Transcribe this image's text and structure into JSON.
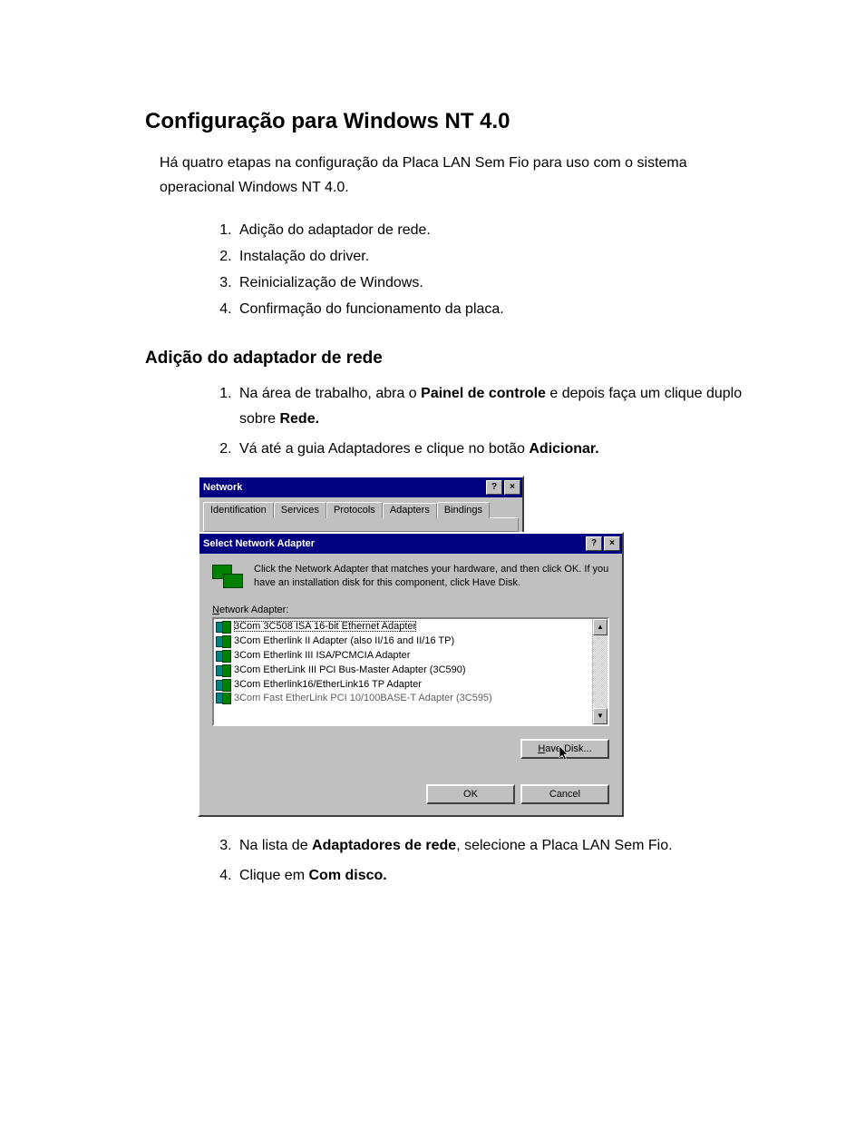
{
  "doc": {
    "title": "Configuração para Windows NT 4.0",
    "intro": "Há quatro etapas na configuração da Placa LAN Sem Fio para uso com o sistema operacional Windows NT 4.0.",
    "steps": [
      "Adição do adaptador de rede.",
      "Instalação do driver.",
      "Reinicialização de Windows.",
      "Confirmação do funcionamento da placa."
    ],
    "section1_title": "Adição do adaptador de rede",
    "sub1": {
      "a_pre": "Na área de trabalho, abra o ",
      "a_b1": "Painel de controle",
      "a_mid": " e depois faça um clique duplo sobre ",
      "a_b2": "Rede.",
      "b_pre": "Vá até a guia Adaptadores e clique no botão ",
      "b_b1": "Adicionar."
    },
    "sub2": {
      "c_pre": "Na lista de ",
      "c_b1": "Adaptadores de rede",
      "c_post": ", selecione a Placa LAN Sem Fio.",
      "d_pre": "Clique em ",
      "d_b1": "Com disco."
    }
  },
  "dialog": {
    "outer_title": "Network",
    "tabs": [
      "Identification",
      "Services",
      "Protocols",
      "Adapters",
      "Bindings"
    ],
    "active_tab_index": 3,
    "inner_title": "Select Network Adapter",
    "instruction": "Click the Network Adapter that matches your hardware, and then click OK.  If you have an installation disk for this component, click Have Disk.",
    "list_label_ul": "N",
    "list_label_rest": "etwork Adapter:",
    "adapters": [
      "3Com 3C508 ISA 16-bit Ethernet Adapter",
      "3Com Etherlink II Adapter (also II/16 and II/16 TP)",
      "3Com Etherlink III ISA/PCMCIA Adapter",
      "3Com EtherLink III PCI Bus-Master Adapter (3C590)",
      "3Com Etherlink16/EtherLink16 TP Adapter",
      "3Com Fast EtherLink PCI 10/100BASE-T Adapter (3C595)"
    ],
    "selected_index": 0,
    "have_disk_ul": "H",
    "have_disk_rest": "ave Disk...",
    "ok": "OK",
    "cancel": "Cancel",
    "help_glyph": "?",
    "close_glyph": "×",
    "scroll_up": "▲",
    "scroll_down": "▼"
  }
}
